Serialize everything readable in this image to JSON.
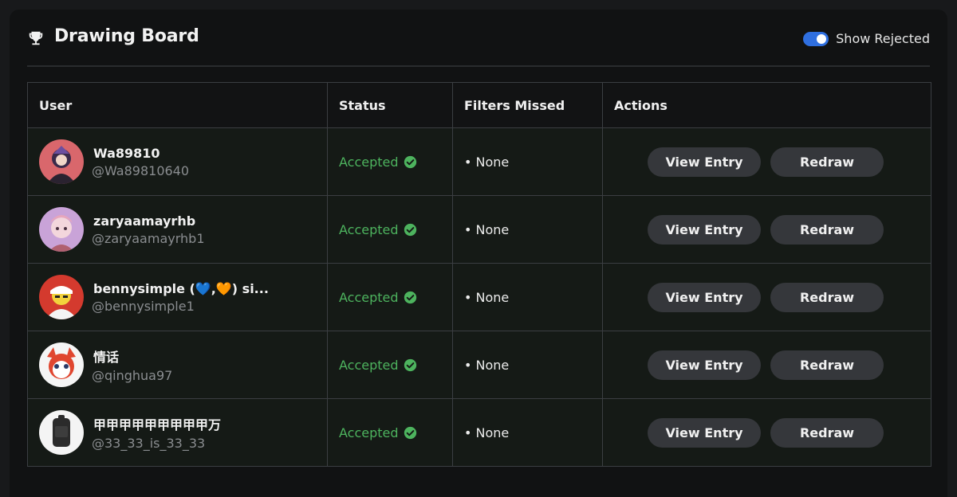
{
  "header": {
    "title": "Drawing Board",
    "toggle_label": "Show Rejected",
    "toggle_on": true
  },
  "table": {
    "columns": [
      "User",
      "Status",
      "Filters Missed",
      "Actions"
    ],
    "rows": [
      {
        "name": "Wa89810",
        "handle": "@Wa89810640",
        "status": "Accepted",
        "filters": "• None",
        "view": "View Entry",
        "redraw": "Redraw"
      },
      {
        "name": "zaryaamayrhb",
        "handle": "@zaryaamayrhb1",
        "status": "Accepted",
        "filters": "• None",
        "view": "View Entry",
        "redraw": "Redraw"
      },
      {
        "name": "bennysimple (💙,🧡) si...",
        "handle": "@bennysimple1",
        "status": "Accepted",
        "filters": "• None",
        "view": "View Entry",
        "redraw": "Redraw"
      },
      {
        "name": "情话",
        "handle": "@qinghua97",
        "status": "Accepted",
        "filters": "• None",
        "view": "View Entry",
        "redraw": "Redraw"
      },
      {
        "name": "甲甲甲甲甲甲甲甲甲万",
        "handle": "@33_33_is_33_33",
        "status": "Accepted",
        "filters": "• None",
        "view": "View Entry",
        "redraw": "Redraw"
      }
    ]
  },
  "colors": {
    "accent": "#2f6fe0",
    "accepted": "#4db35e",
    "button_bg": "#35373b"
  },
  "icons": {
    "header": "trophy-icon",
    "status": "check-circle-icon"
  }
}
